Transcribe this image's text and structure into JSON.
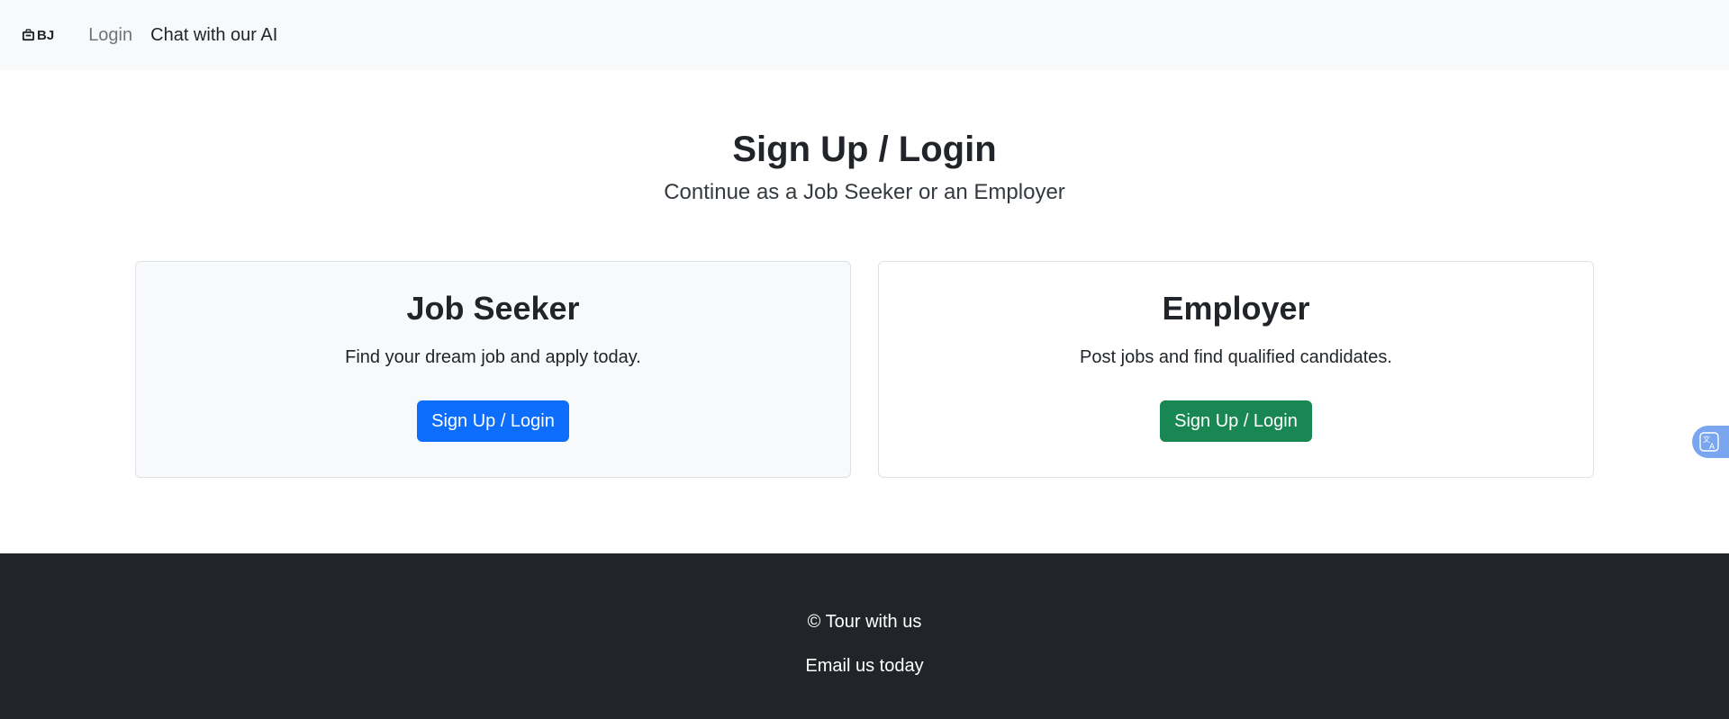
{
  "navbar": {
    "brand_text": "BJ",
    "brand_icon": "briefcase-icon",
    "links": [
      {
        "label": "Login"
      },
      {
        "label": "Chat with our AI"
      }
    ]
  },
  "hero": {
    "title": "Sign Up / Login",
    "subtitle": "Continue as a Job Seeker or an Employer"
  },
  "cards": [
    {
      "title": "Job Seeker",
      "description": "Find your dream job and apply today.",
      "button_label": "Sign Up / Login",
      "button_color": "#0d6efd"
    },
    {
      "title": "Employer",
      "description": "Post jobs and find qualified candidates.",
      "button_label": "Sign Up / Login",
      "button_color": "#198754"
    }
  ],
  "footer": {
    "copyright": "© Tour with us",
    "email_link": "Email us today"
  },
  "widgets": {
    "translate_icon": "translate-icon"
  },
  "colors": {
    "navbar_bg": "#f8f9fa",
    "footer_bg": "#212529",
    "primary": "#0d6efd",
    "success": "#198754"
  }
}
